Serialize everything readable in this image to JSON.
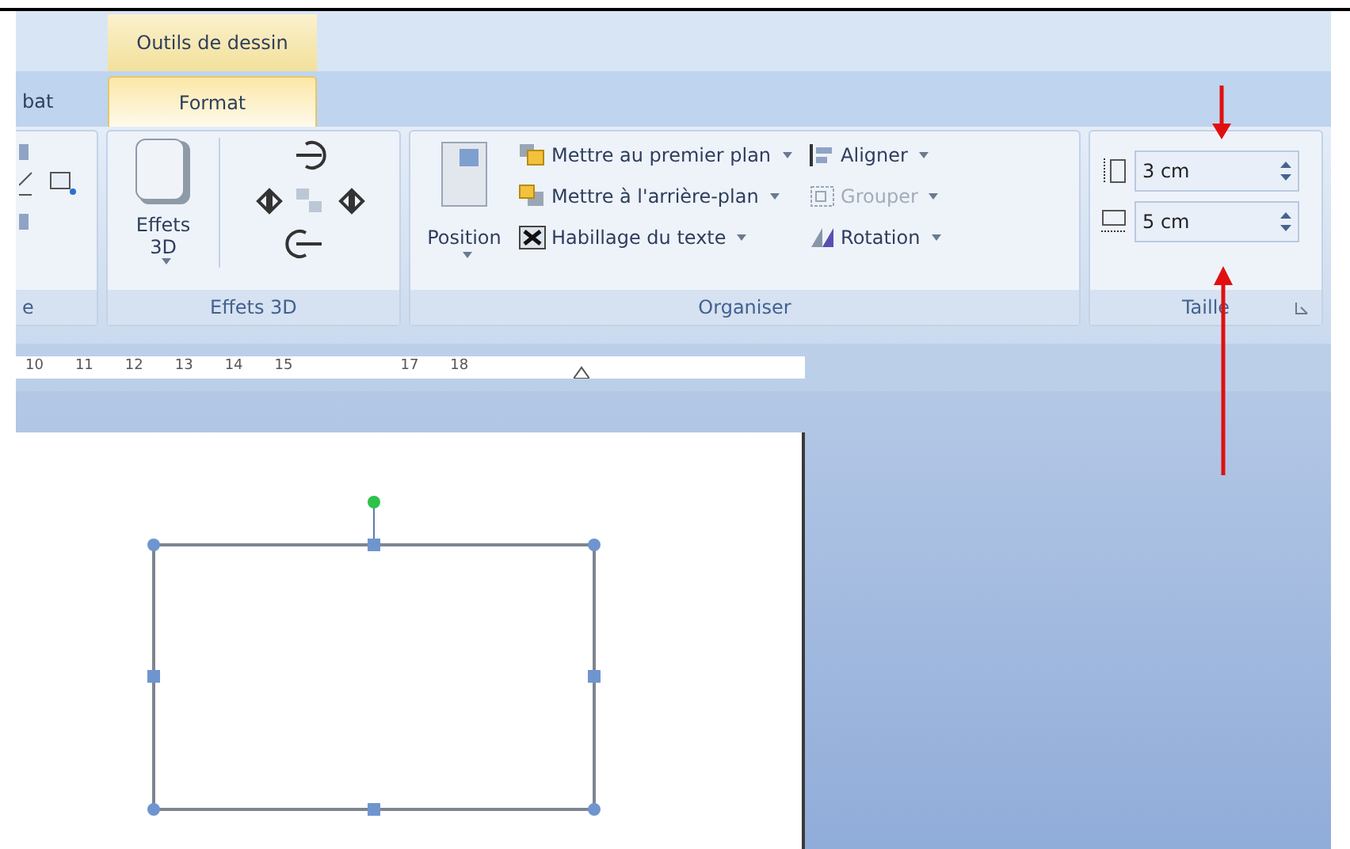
{
  "context_tab": {
    "label": "Outils de dessin"
  },
  "tabs": [
    {
      "label": "bat",
      "selected": false
    },
    {
      "label": "Format",
      "selected": true
    }
  ],
  "partial_group": {
    "label": "e"
  },
  "effets_3d": {
    "button": "Effets 3D",
    "label": "Effets 3D"
  },
  "organiser": {
    "position": "Position",
    "label": "Organiser",
    "commands": [
      {
        "label": "Mettre au premier plan",
        "disabled": false
      },
      {
        "label": "Aligner",
        "disabled": false
      },
      {
        "label": "Mettre à l'arrière-plan",
        "disabled": false
      },
      {
        "label": "Grouper",
        "disabled": true
      },
      {
        "label": "Habillage du texte",
        "disabled": false
      },
      {
        "label": "Rotation",
        "disabled": false
      }
    ]
  },
  "taille": {
    "label": "Taille",
    "fields": [
      {
        "value": "3 cm"
      },
      {
        "value": "5 cm"
      }
    ]
  },
  "ruler": {
    "marks": [
      "10",
      "11",
      "12",
      "13",
      "14",
      "15",
      "17",
      "18"
    ]
  }
}
